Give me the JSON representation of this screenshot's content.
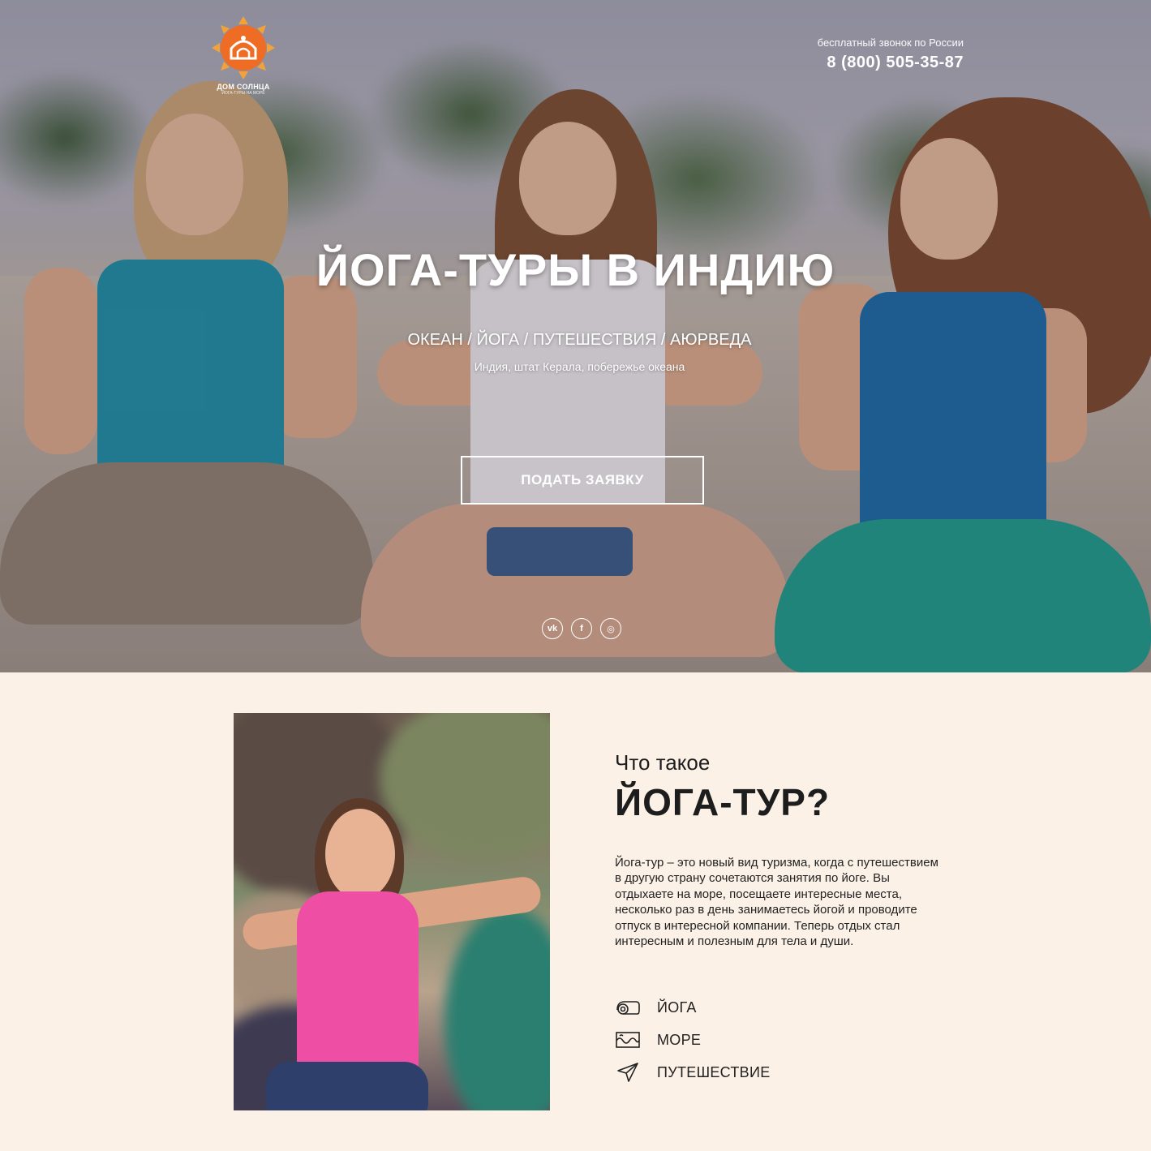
{
  "header": {
    "logo_name": "ДОМ СОЛНЦА",
    "logo_tagline": "ЙОГА-ТУРЫ НА МОРЕ",
    "phone_caption": "бесплатный звонок по России",
    "phone_number": "8 (800) 505-35-87"
  },
  "hero": {
    "title": "ЙОГА-ТУРЫ В ИНДИЮ",
    "tags": "ОКЕАН / ЙОГА / ПУТЕШЕСТВИЯ / АЮРВЕДА",
    "location": "Индия, штат Керала, побережье океана",
    "cta_label": "ПОДАТЬ ЗАЯВКУ"
  },
  "socials": [
    {
      "icon": "vk-icon",
      "glyph": "vk"
    },
    {
      "icon": "facebook-icon",
      "glyph": "f"
    },
    {
      "icon": "instagram-icon",
      "glyph": "◎"
    }
  ],
  "about": {
    "subtitle": "Что такое",
    "title": "ЙОГА-ТУР?",
    "text": "Йога-тур – это новый вид туризма, когда с путешествием в другую страну сочетаются занятия по йоге. Вы отдыхаете на море, посещаете интересные места, несколько раз в день занимаетесь йогой и проводите отпуск в интересной компании. Теперь отдых стал интересным и полезным для тела и души.",
    "features": [
      {
        "label": "ЙОГА",
        "icon": "yoga-mat-icon"
      },
      {
        "label": "МОРЕ",
        "icon": "waves-icon"
      },
      {
        "label": "ПУТЕШЕСТВИЕ",
        "icon": "paper-plane-icon"
      }
    ]
  },
  "colors": {
    "accent": "#f07a24",
    "section_bg": "#fcf1e7",
    "text": "#1d1d1d"
  }
}
